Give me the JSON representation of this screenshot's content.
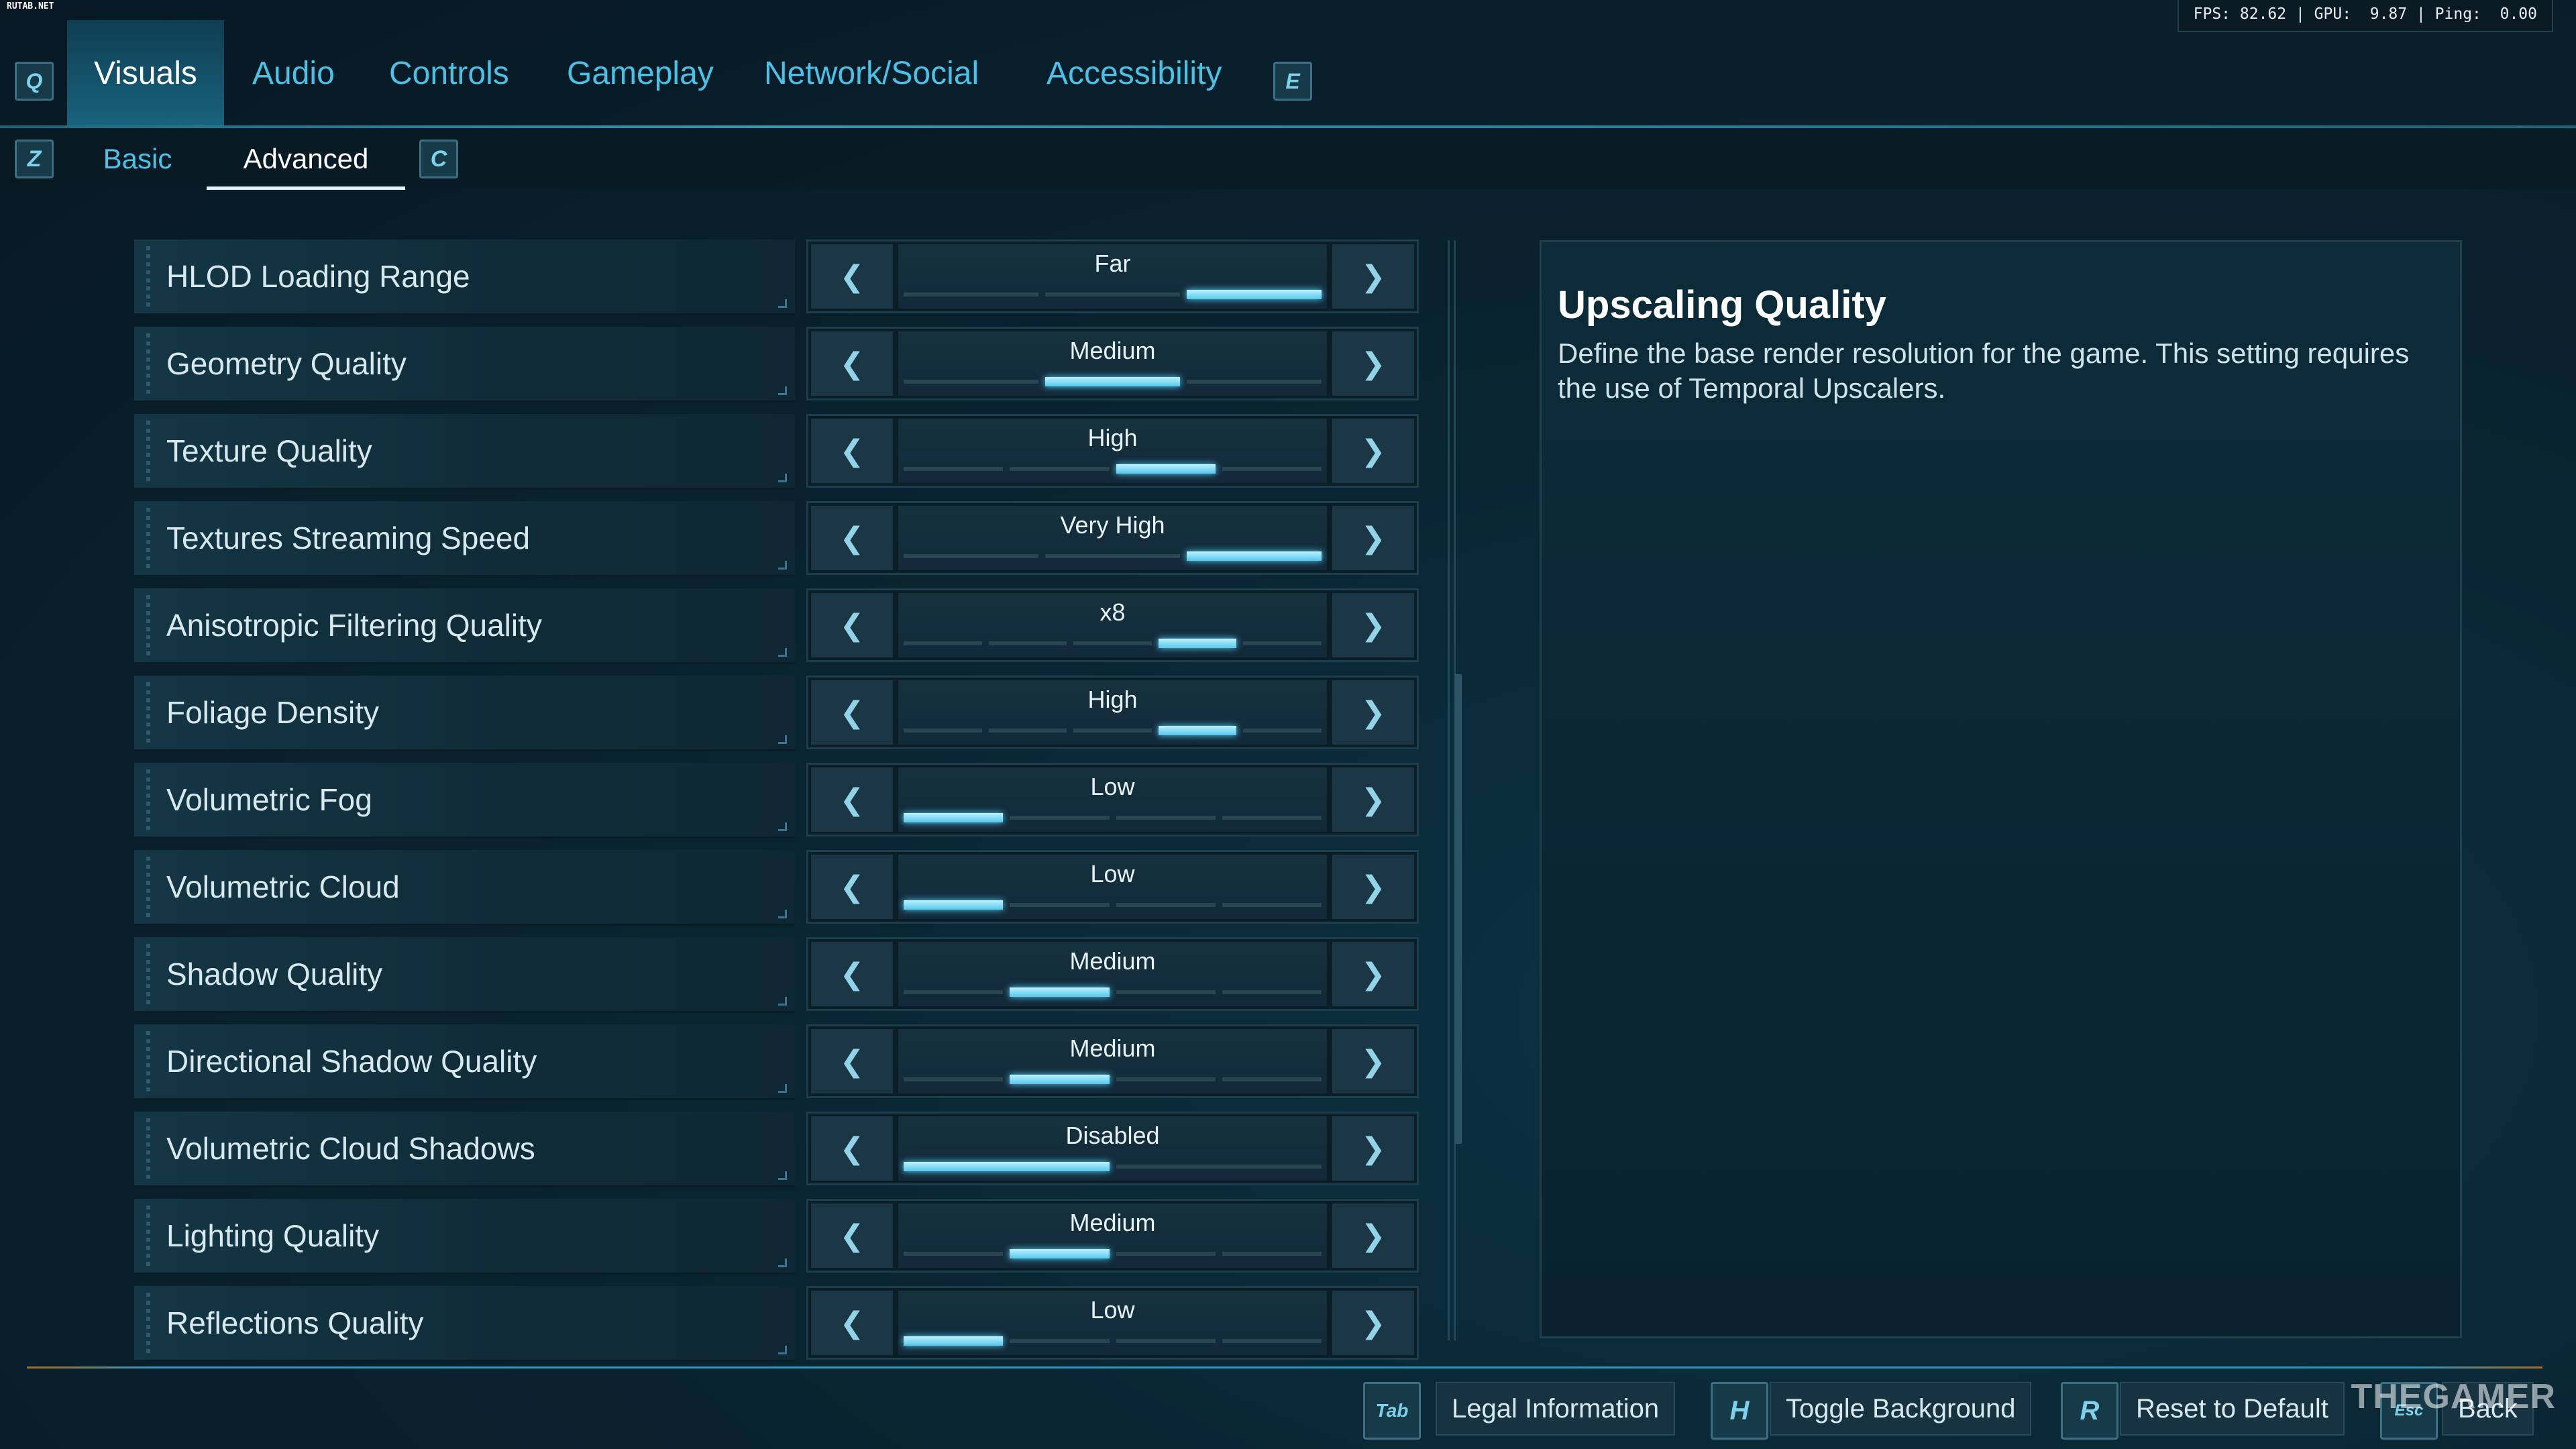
{
  "watermark": "RUTAB.NET",
  "status_bar": "FPS: 82.62 | GPU:  9.87 | Ping:  0.00",
  "tab_keys": {
    "prev": "Q",
    "next": "E"
  },
  "tabs": [
    "Visuals",
    "Audio",
    "Controls",
    "Gameplay",
    "Network/Social",
    "Accessibility"
  ],
  "active_tab": "Visuals",
  "subtab_keys": {
    "prev": "Z",
    "next": "C"
  },
  "subtabs": [
    "Basic",
    "Advanced"
  ],
  "active_subtab": "Advanced",
  "settings": [
    {
      "label": "HLOD Loading Range",
      "value": "Far",
      "segments": 3,
      "selected_index": 2
    },
    {
      "label": "Geometry Quality",
      "value": "Medium",
      "segments": 3,
      "selected_index": 1
    },
    {
      "label": "Texture Quality",
      "value": "High",
      "segments": 4,
      "selected_index": 2
    },
    {
      "label": "Textures Streaming Speed",
      "value": "Very High",
      "segments": 3,
      "selected_index": 2
    },
    {
      "label": "Anisotropic Filtering Quality",
      "value": "x8",
      "segments": 5,
      "selected_index": 3
    },
    {
      "label": "Foliage Density",
      "value": "High",
      "segments": 5,
      "selected_index": 3
    },
    {
      "label": "Volumetric Fog",
      "value": "Low",
      "segments": 4,
      "selected_index": 0
    },
    {
      "label": "Volumetric Cloud",
      "value": "Low",
      "segments": 4,
      "selected_index": 0
    },
    {
      "label": "Shadow Quality",
      "value": "Medium",
      "segments": 4,
      "selected_index": 1
    },
    {
      "label": "Directional Shadow Quality",
      "value": "Medium",
      "segments": 4,
      "selected_index": 1
    },
    {
      "label": "Volumetric Cloud Shadows",
      "value": "Disabled",
      "segments": 2,
      "selected_index": 0
    },
    {
      "label": "Lighting Quality",
      "value": "Medium",
      "segments": 4,
      "selected_index": 1
    },
    {
      "label": "Reflections Quality",
      "value": "Low",
      "segments": 4,
      "selected_index": 0
    }
  ],
  "info": {
    "title": "Upscaling Quality",
    "description": "Define the base render resolution for the game. This setting requires the use of Temporal Upscalers."
  },
  "footer": [
    {
      "key": "Tab",
      "label": "Legal Information"
    },
    {
      "key": "H",
      "label": "Toggle Background"
    },
    {
      "key": "R",
      "label": "Reset to Default"
    },
    {
      "key": "Esc",
      "label": "Back"
    }
  ],
  "brand_logo": "THEGAMER",
  "colors": {
    "accent": "#4cc1e6",
    "active_segment": "#56c8ec",
    "background": "#0a2431"
  }
}
